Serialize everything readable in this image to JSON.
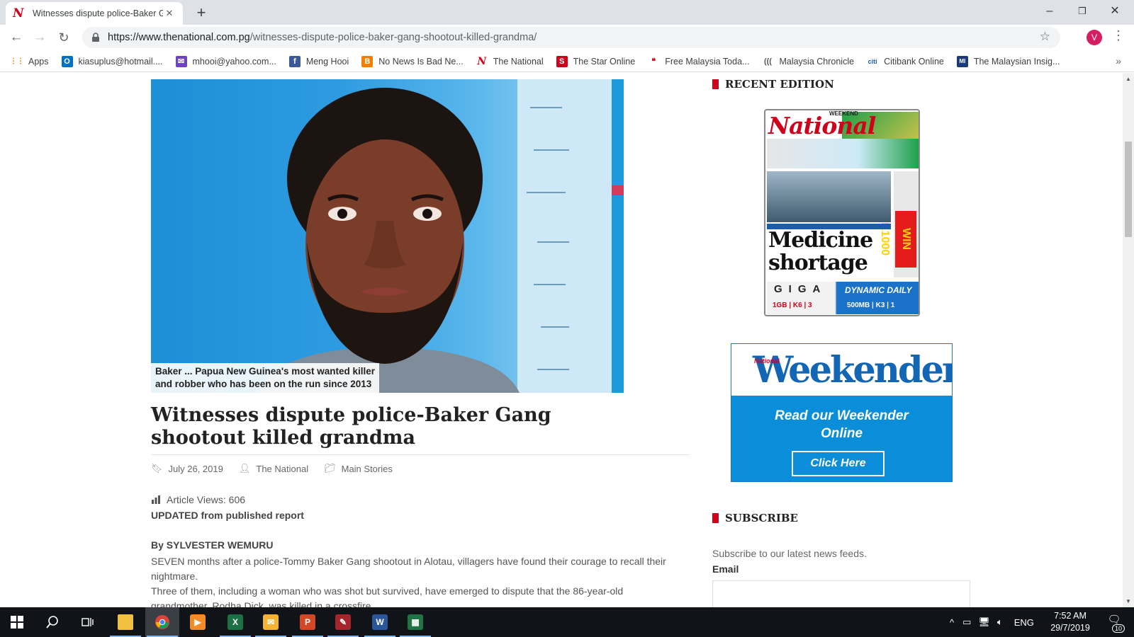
{
  "browser": {
    "tab_title": "Witnesses dispute police-Baker Gang",
    "tab_favicon": "N",
    "url_host": "https://www.thenational.com.pg",
    "url_path": "/witnesses-dispute-police-baker-gang-shootout-killed-grandma/",
    "profile_initial": "V",
    "bookmarks": [
      {
        "label": "Apps",
        "icon": "apps-grid-icon",
        "color": "#4285f4",
        "glyph": "⋮⋮"
      },
      {
        "label": "kiasuplus@hotmail....",
        "icon": "outlook-icon",
        "color": "#0072c6",
        "glyph": "O"
      },
      {
        "label": "mhooi@yahoo.com...",
        "icon": "mail-icon",
        "color": "#6f42c1",
        "glyph": "✉"
      },
      {
        "label": "Meng Hooi",
        "icon": "facebook-icon",
        "color": "#3b5998",
        "glyph": "f"
      },
      {
        "label": "No News Is Bad Ne...",
        "icon": "blogger-icon",
        "color": "#f57d00",
        "glyph": "B"
      },
      {
        "label": "The National",
        "icon": "national-icon",
        "color": "#ffffff",
        "glyph": "N"
      },
      {
        "label": "The Star Online",
        "icon": "star-online-icon",
        "color": "#d0021b",
        "glyph": "S"
      },
      {
        "label": "Free Malaysia Toda...",
        "icon": "fmt-icon",
        "color": "#ffffff",
        "glyph": "❝"
      },
      {
        "label": "Malaysia Chronicle",
        "icon": "chronicle-icon",
        "color": "#ffffff",
        "glyph": "((("
      },
      {
        "label": "Citibank Online",
        "icon": "citi-icon",
        "color": "#ffffff",
        "glyph": "citi"
      },
      {
        "label": "The Malaysian Insig...",
        "icon": "insight-icon",
        "color": "#1a3a7a",
        "glyph": "MI"
      }
    ]
  },
  "article": {
    "photo_caption_line1": "Baker ... Papua New Guinea's most wanted killer",
    "photo_caption_line2": "and robber who has been on the run since 2013",
    "headline": "Witnesses dispute police-Baker Gang shootout killed grandma",
    "date": "July 26, 2019",
    "author": "The National",
    "category": "Main Stories",
    "views": "Article Views: 606",
    "updated": "UPDATED from published report",
    "byline": "By SYLVESTER WEMURU",
    "paragraph1": "SEVEN months after a police-Tommy Baker Gang shootout in Alotau, villagers have found their courage to recall their nightmare.",
    "paragraph2": "Three of them, including a woman who was shot but survived, have emerged to dispute that the 86-year-old grandmother, Rodha Dick, was killed in a crossfire."
  },
  "sidebar": {
    "recent_edition_title": "RECENT EDITION",
    "cover": {
      "masthead": "National",
      "weekend": "WEEKEND",
      "headline_line1": "Medicine",
      "headline_line2": "shortage",
      "win": "WIN K1000",
      "giga": "GIGA",
      "giga_prices": "1GB | K6 | 3",
      "dynamic": "DYNAMIC DAILY",
      "dynamic_prices": "500MB | K3 | 1"
    },
    "weekender": {
      "brand": "National",
      "title": "Weekender",
      "text_line1": "Read our Weekender",
      "text_line2": "Online",
      "button": "Click Here"
    },
    "subscribe_title": "SUBSCRIBE",
    "subscribe_desc": "Subscribe to our latest news feeds.",
    "email_label": "Email"
  },
  "taskbar": {
    "language": "ENG",
    "time": "7:52 AM",
    "date": "29/7/2019",
    "notification_count": "10"
  }
}
